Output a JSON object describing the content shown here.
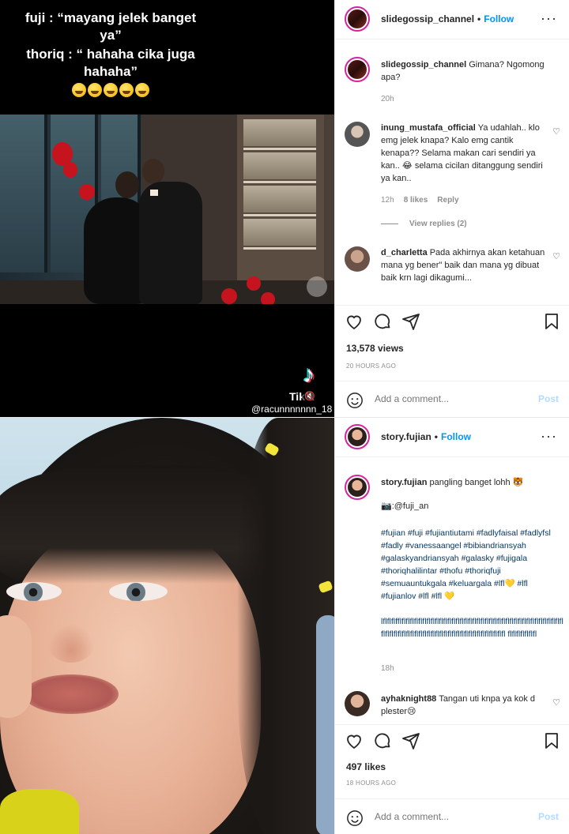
{
  "post1": {
    "overlay_line1": "fuji : “mayang jelek banget ya”",
    "overlay_line2": "thoriq : “ hahaha cika juga hahaha”",
    "tiktok_word": "Tik    k",
    "tiktok_handle": "@racunnnnnnn_18",
    "header": {
      "username": "slidegossip_channel",
      "dot": "•",
      "follow": "Follow",
      "more": "···"
    },
    "caption": {
      "username": "slidegossip_channel",
      "text": "Gimana? Ngomong apa?",
      "time": "20h"
    },
    "comments": [
      {
        "username": "inung_mustafa_official",
        "text": "Ya udahlah.. klo emg jelek knapa? Kalo emg cantik kenapa?? Selama makan cari sendiri ya kan.. 😂 selama cicilan ditanggung sendiri ya kan..",
        "time": "12h",
        "likes": "8 likes",
        "reply": "Reply",
        "view_replies": "View replies (2)"
      },
      {
        "username": "d_charletta",
        "text": "Pada akhirnya akan ketahuan mana yg bener\" baik dan mana yg dibuat baik krn lagi dikagumi..."
      }
    ],
    "views": "13,578 views",
    "age": "20 HOURS AGO",
    "add_comment_placeholder": "Add a comment...",
    "post_label": "Post"
  },
  "post2": {
    "header": {
      "username": "story.fujian",
      "dot": "•",
      "follow": "Follow",
      "more": "···"
    },
    "caption": {
      "username": "story.fujian",
      "text": "pangling banget lohh 🐯",
      "credit": "📷:@fuji_an",
      "hashtags": "#fujian #fuji #fujiantiutami #fadlyfaisal #fadlyfsl #fadly #vanessaangel #bibiandriansyah #galaskyandriansyah #galasky #fujigala #thoriqhalilintar #thofu #thoriqfuji #semuauntukgala #keluargala #lfl💛 #lfl #fujianlov #lfl #lfl 💛",
      "lfl_text": "lflflflfflflflflflflflflflflflflflflflflflflflflflflflflflflflflflflflflflflflflflflflflflflflflflflflflflflflflflflflflflflflflflflflflflflflflflfl flflflflflflfl",
      "time": "18h"
    },
    "comments": [
      {
        "username": "ayhaknight88",
        "text": "Tangan uti knpa ya kok d plester😢"
      }
    ],
    "likes": "497 likes",
    "age": "18 HOURS AGO",
    "add_comment_placeholder": "Add a comment...",
    "post_label": "Post"
  },
  "icons": {
    "heart": "heart-icon",
    "comment": "comment-icon",
    "share": "share-icon",
    "save": "bookmark-icon",
    "emoji": "emoji-icon",
    "more": "more-icon",
    "tiktok": "tiktok-logo",
    "mute": "mute-icon"
  },
  "colors": {
    "follow": "#0095f6",
    "muted": "#8e8e8e",
    "text": "#262626",
    "hashtag": "#00376b",
    "post_disabled": "#b3dbff"
  }
}
